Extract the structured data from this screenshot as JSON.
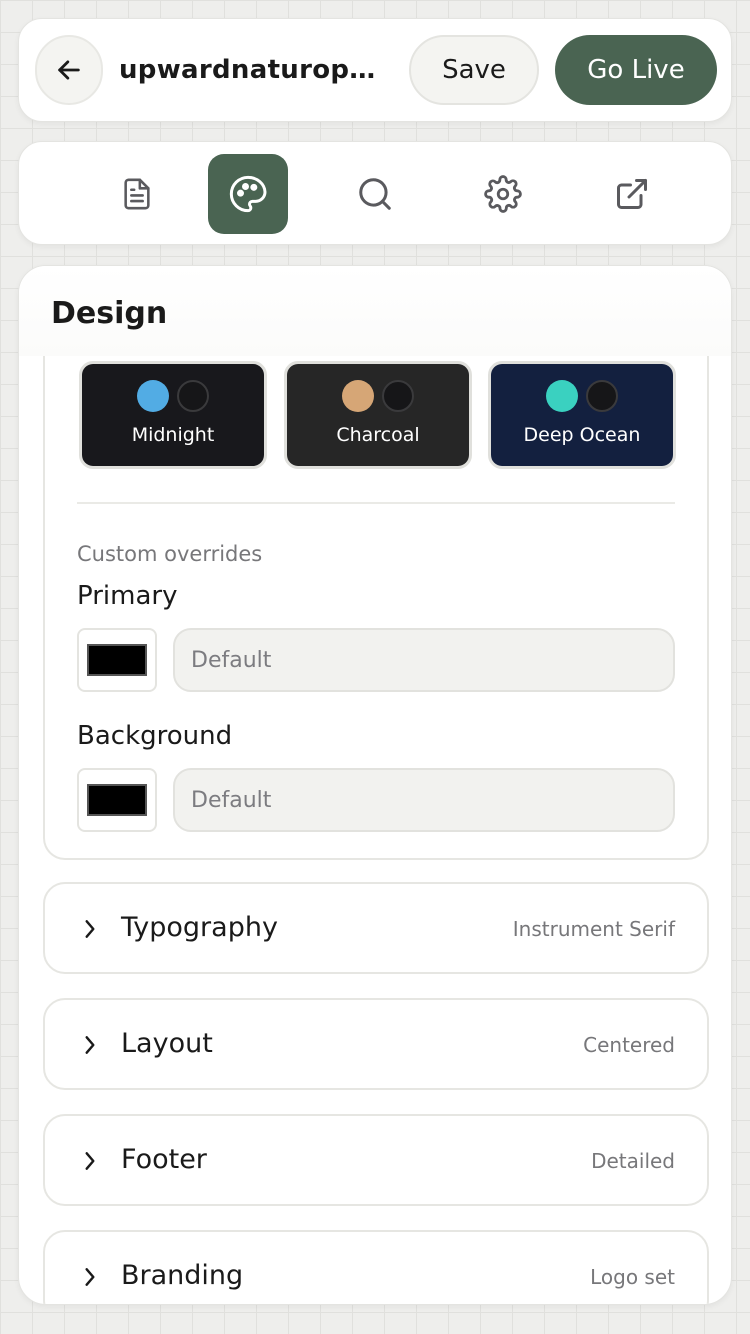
{
  "header": {
    "title": "upwardnaturop…",
    "save_label": "Save",
    "go_live_label": "Go Live",
    "accent_color": "#4a6452"
  },
  "toolbar": {
    "tools": [
      {
        "icon": "document-icon",
        "active": false
      },
      {
        "icon": "palette-icon",
        "active": true
      },
      {
        "icon": "search-icon",
        "active": false
      },
      {
        "icon": "gear-icon",
        "active": false
      },
      {
        "icon": "external-link-icon",
        "active": false
      }
    ]
  },
  "design": {
    "title": "Design",
    "themes": [
      {
        "label": "Midnight",
        "background": "#18181c",
        "accent": "#52ace4"
      },
      {
        "label": "Charcoal",
        "background": "#262626",
        "accent": "#d6a676"
      },
      {
        "label": "Deep Ocean",
        "background": "#13203f",
        "accent": "#3ad1c0"
      }
    ],
    "overrides_label": "Custom overrides",
    "primary": {
      "label": "Primary",
      "placeholder": "Default",
      "swatch": "#000000"
    },
    "background": {
      "label": "Background",
      "placeholder": "Default",
      "swatch": "#000000"
    }
  },
  "sections": [
    {
      "title": "Typography",
      "value": "Instrument Serif"
    },
    {
      "title": "Layout",
      "value": "Centered"
    },
    {
      "title": "Footer",
      "value": "Detailed"
    },
    {
      "title": "Branding",
      "value": "Logo set"
    }
  ]
}
